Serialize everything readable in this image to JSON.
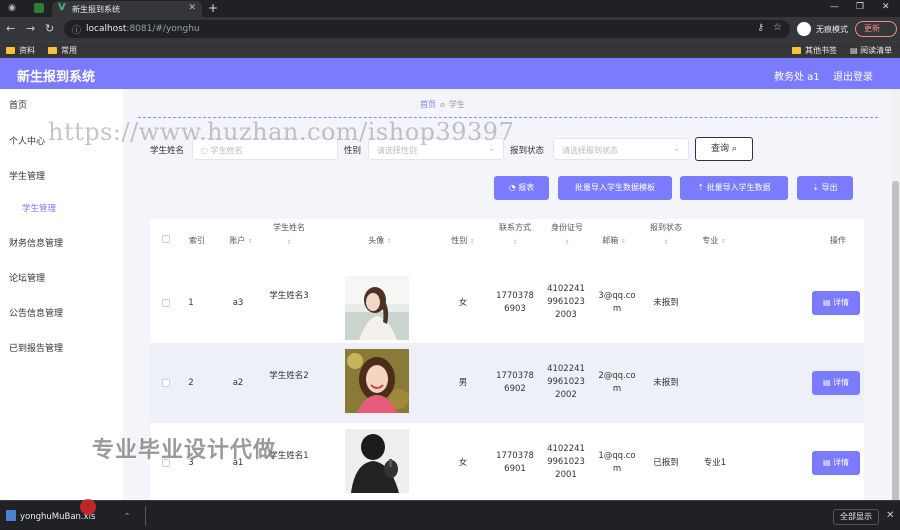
{
  "browser": {
    "active_tab_title": "新生报到系统",
    "url_host": "localhost",
    "url_rest": ":8081/#/yonghu",
    "incognito_label": "无痕模式",
    "update_label": "更新",
    "bookmarks": [
      "资料",
      "常用"
    ],
    "bookmarks_right": [
      "其他书签",
      "阅读清单"
    ]
  },
  "app": {
    "title": "新生报到系统",
    "role_label": "教务处 a1",
    "logout_label": "退出登录"
  },
  "sidebar": {
    "items": [
      {
        "label": "首页"
      },
      {
        "label": "个人中心"
      },
      {
        "label": "学生管理"
      },
      {
        "label": "学生管理"
      },
      {
        "label": "财务信息管理"
      },
      {
        "label": "论坛管理"
      },
      {
        "label": "公告信息管理"
      },
      {
        "label": "已到报告管理"
      }
    ]
  },
  "breadcrumb": {
    "home": "首页",
    "current": "学生"
  },
  "filters": {
    "name_label": "学生姓名",
    "name_placeholder": "学生姓名",
    "gender_label": "性别",
    "gender_placeholder": "请选择性别",
    "status_label": "报到状态",
    "status_placeholder": "请选择报到状态",
    "search_label": "查询"
  },
  "actions": {
    "report": "报表",
    "batch_import_template": "批量导入学生数据模板",
    "batch_import": "批量导入学生数据",
    "export": "导出"
  },
  "table": {
    "headers": {
      "index": "索引",
      "account": "账户",
      "name": "学生姓名",
      "avatar": "头像",
      "gender": "性别",
      "phone": "联系方式",
      "idcard": "身份证号",
      "email": "邮箱",
      "status": "报到状态",
      "major": "专业",
      "ops": "操作"
    },
    "rows": [
      {
        "index": "1",
        "account": "a3",
        "name": "学生姓名3",
        "gender": "女",
        "phone": "17703786903",
        "idcard": "410224199610232003",
        "email": "3@qq.com",
        "status": "未报到",
        "major": "",
        "detail": "详情"
      },
      {
        "index": "2",
        "account": "a2",
        "name": "学生姓名2",
        "gender": "男",
        "phone": "17703786902",
        "idcard": "410224199610232002",
        "email": "2@qq.com",
        "status": "未报到",
        "major": "",
        "detail": "详情"
      },
      {
        "index": "3",
        "account": "a1",
        "name": "学生姓名1",
        "gender": "女",
        "phone": "17703786901",
        "idcard": "410224199610232001",
        "email": "1@qq.com",
        "status": "已报到",
        "major": "专业1",
        "detail": "详情"
      }
    ]
  },
  "watermarks": {
    "url": "https://www.huzhan.com/ishop39397",
    "slogan": "专业毕业设计代做"
  },
  "downloads": {
    "file": "yonghuMuBan.xls",
    "show_all": "全部显示"
  },
  "colors": {
    "accent": "#7b7bff"
  }
}
